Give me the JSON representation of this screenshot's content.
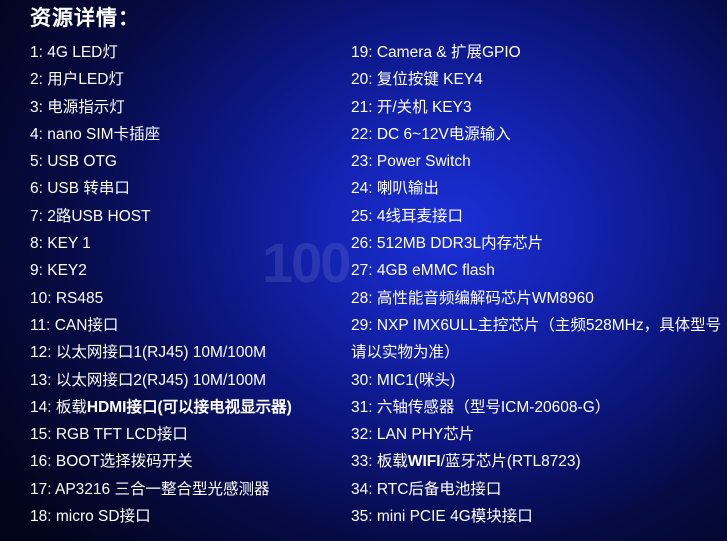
{
  "heading": "资源详情：",
  "watermark": "100",
  "left": [
    {
      "num": "1: ",
      "text": "4G LED灯"
    },
    {
      "num": "2: ",
      "text": "用户LED灯"
    },
    {
      "num": "3: ",
      "text": "电源指示灯"
    },
    {
      "num": "4: ",
      "text": "nano SIM卡插座"
    },
    {
      "num": "5: ",
      "text": "USB OTG"
    },
    {
      "num": "6: ",
      "text": " USB 转串口"
    },
    {
      "num": "7: ",
      "text": "2路USB HOST"
    },
    {
      "num": "8: ",
      "text": "KEY 1"
    },
    {
      "num": "9: ",
      "text": "KEY2"
    },
    {
      "num": "10: ",
      "text": "RS485"
    },
    {
      "num": "11: ",
      "text": "CAN接口"
    },
    {
      "num": "12: ",
      "text": "以太网接口1(RJ45) 10M/100M"
    },
    {
      "num": "13: ",
      "text": "以太网接口2(RJ45) 10M/100M"
    },
    {
      "num": "14: ",
      "pre": "板载",
      "bold": "HDMI接口(可以接电视显示器)",
      "post": ""
    },
    {
      "num": "15: ",
      "text": "RGB TFT LCD接口"
    },
    {
      "num": "16: ",
      "text": "BOOT选择拨码开关"
    },
    {
      "num": "17: ",
      "text": "AP3216 三合一整合型光感测器"
    },
    {
      "num": "18: ",
      "text": "micro SD接口"
    }
  ],
  "right": [
    {
      "num": "19: ",
      "text": "Camera & 扩展GPIO"
    },
    {
      "num": "20: ",
      "text": "复位按键 KEY4"
    },
    {
      "num": "21: ",
      "text": "开/关机 KEY3"
    },
    {
      "num": "22: ",
      "text": "DC 6~12V电源输入"
    },
    {
      "num": "23: ",
      "text": "Power Switch"
    },
    {
      "num": "24: ",
      "text": "喇叭输出"
    },
    {
      "num": "25: ",
      "text": "4线耳麦接口"
    },
    {
      "num": "26: ",
      "text": "512MB DDR3L内存芯片"
    },
    {
      "num": "27: ",
      "text": "4GB eMMC flash"
    },
    {
      "num": "28: ",
      "text": "高性能音频编解码芯片WM8960"
    },
    {
      "num": "29: ",
      "text": "NXP IMX6ULL主控芯片（主频528MHz，具体型号请以实物为准）",
      "wrap": true
    },
    {
      "num": "30: ",
      "text": "MIC1(咪头)"
    },
    {
      "num": "31: ",
      "text": "六轴传感器（型号ICM-20608-G）"
    },
    {
      "num": "32: ",
      "text": "LAN PHY芯片"
    },
    {
      "num": "33: ",
      "pre": "板载",
      "bold": "WIFI",
      "post": "/蓝牙芯片(RTL8723)"
    },
    {
      "num": "34: ",
      "text": "RTC后备电池接口"
    },
    {
      "num": "35: ",
      "text": "mini PCIE 4G模块接口"
    }
  ]
}
